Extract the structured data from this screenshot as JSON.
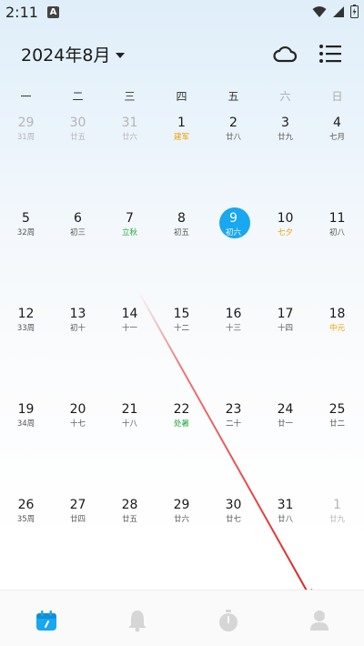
{
  "status_bar": {
    "time": "2:11",
    "notification_badge": "A"
  },
  "header": {
    "month_title": "2024年8月"
  },
  "weekdays": [
    "一",
    "二",
    "三",
    "四",
    "五",
    "六",
    "日"
  ],
  "weeks": [
    [
      {
        "num": "29",
        "sub": "31周",
        "other": true
      },
      {
        "num": "30",
        "sub": "廿五",
        "other": true
      },
      {
        "num": "31",
        "sub": "廿六",
        "other": true
      },
      {
        "num": "1",
        "sub": "建军",
        "style": "festival-orange"
      },
      {
        "num": "2",
        "sub": "廿八"
      },
      {
        "num": "3",
        "sub": "廿九"
      },
      {
        "num": "4",
        "sub": "七月"
      }
    ],
    [
      {
        "num": "5",
        "sub": "32周"
      },
      {
        "num": "6",
        "sub": "初三"
      },
      {
        "num": "7",
        "sub": "立秋",
        "style": "festival-green"
      },
      {
        "num": "8",
        "sub": "初五"
      },
      {
        "num": "9",
        "sub": "初六",
        "today": true
      },
      {
        "num": "10",
        "sub": "七夕",
        "style": "festival-orange"
      },
      {
        "num": "11",
        "sub": "初八"
      }
    ],
    [
      {
        "num": "12",
        "sub": "33周"
      },
      {
        "num": "13",
        "sub": "初十"
      },
      {
        "num": "14",
        "sub": "十一"
      },
      {
        "num": "15",
        "sub": "十二"
      },
      {
        "num": "16",
        "sub": "十三"
      },
      {
        "num": "17",
        "sub": "十四"
      },
      {
        "num": "18",
        "sub": "中元",
        "style": "festival-orange"
      }
    ],
    [
      {
        "num": "19",
        "sub": "34周"
      },
      {
        "num": "20",
        "sub": "十七"
      },
      {
        "num": "21",
        "sub": "十八"
      },
      {
        "num": "22",
        "sub": "处暑",
        "style": "festival-green"
      },
      {
        "num": "23",
        "sub": "二十"
      },
      {
        "num": "24",
        "sub": "廿一"
      },
      {
        "num": "25",
        "sub": "廿二"
      }
    ],
    [
      {
        "num": "26",
        "sub": "35周"
      },
      {
        "num": "27",
        "sub": "廿四"
      },
      {
        "num": "28",
        "sub": "廿五"
      },
      {
        "num": "29",
        "sub": "廿六"
      },
      {
        "num": "30",
        "sub": "廿七"
      },
      {
        "num": "31",
        "sub": "廿八"
      },
      {
        "num": "1",
        "sub": "廿九",
        "other": true
      }
    ]
  ],
  "bottom_nav": [
    {
      "name": "calendar-tab",
      "icon": "calendar-icon",
      "active": true
    },
    {
      "name": "reminder-tab",
      "icon": "bell-icon"
    },
    {
      "name": "timer-tab",
      "icon": "stopwatch-icon"
    },
    {
      "name": "profile-tab",
      "icon": "user-icon"
    }
  ],
  "colors": {
    "accent": "#19a7f0",
    "festival_orange": "#f0a000",
    "festival_green": "#1faa3c",
    "annotation_arrow": "#e02020"
  }
}
